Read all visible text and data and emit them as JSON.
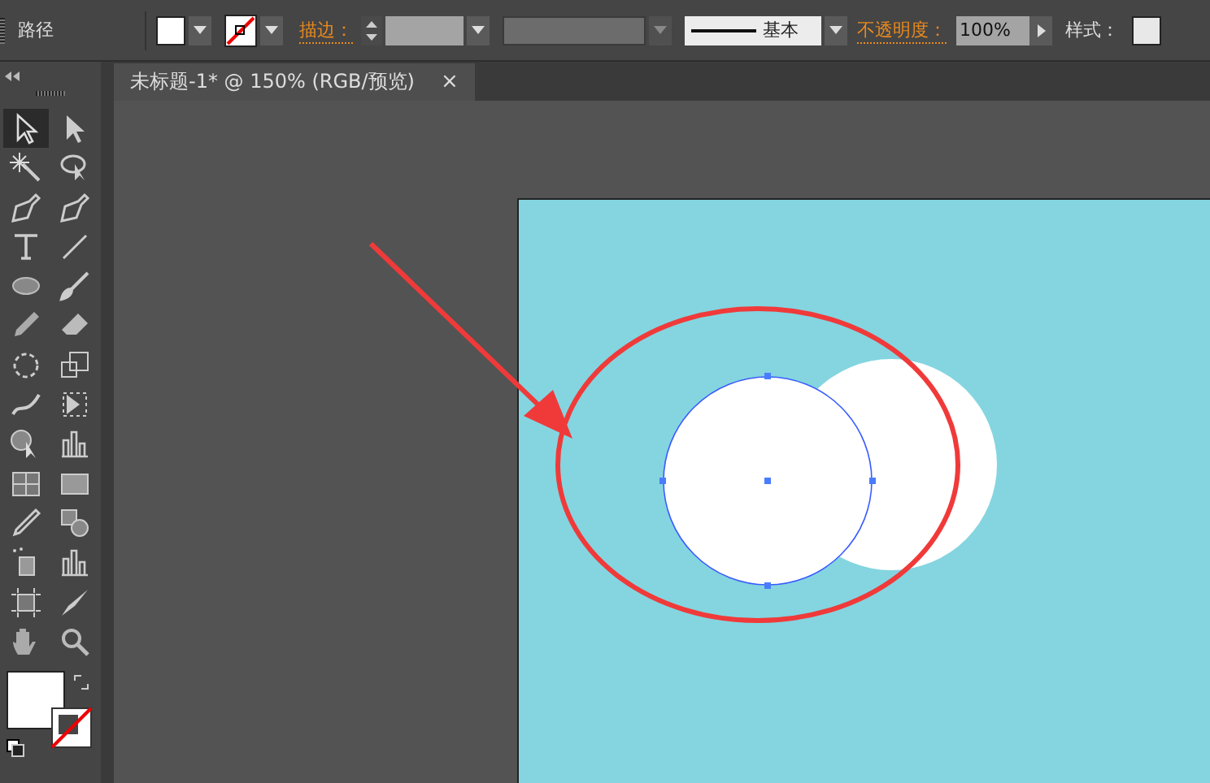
{
  "control_bar": {
    "label": "路径",
    "stroke_label": "描边：",
    "stroke_profile": "基本",
    "opacity_label": "不透明度：",
    "opacity_value": "100%",
    "style_label": "样式："
  },
  "document_tab": {
    "title": "未标题-1* @ 150% (RGB/预览)",
    "close": "×"
  },
  "tools": [
    {
      "kind": "selection",
      "selected": true
    },
    {
      "kind": "direct-selection",
      "selected": false
    },
    {
      "kind": "magic-wand",
      "selected": false
    },
    {
      "kind": "lasso",
      "selected": false
    },
    {
      "kind": "pen",
      "selected": false
    },
    {
      "kind": "curvature-pen",
      "selected": false
    },
    {
      "kind": "type",
      "selected": false
    },
    {
      "kind": "line",
      "selected": false
    },
    {
      "kind": "ellipse",
      "selected": false
    },
    {
      "kind": "brush",
      "selected": false
    },
    {
      "kind": "pencil",
      "selected": false
    },
    {
      "kind": "eraser",
      "selected": false
    },
    {
      "kind": "rotate",
      "selected": false
    },
    {
      "kind": "scale",
      "selected": false
    },
    {
      "kind": "warp",
      "selected": false
    },
    {
      "kind": "free-transform",
      "selected": false
    },
    {
      "kind": "shape-builder",
      "selected": false
    },
    {
      "kind": "graph",
      "selected": false
    },
    {
      "kind": "mesh",
      "selected": false
    },
    {
      "kind": "gradient",
      "selected": false
    },
    {
      "kind": "eyedropper",
      "selected": false
    },
    {
      "kind": "blend",
      "selected": false
    },
    {
      "kind": "sprayer",
      "selected": false
    },
    {
      "kind": "column-graph",
      "selected": false
    },
    {
      "kind": "artboard",
      "selected": false
    },
    {
      "kind": "slice",
      "selected": false
    },
    {
      "kind": "hand",
      "selected": false
    },
    {
      "kind": "zoom",
      "selected": false
    }
  ]
}
